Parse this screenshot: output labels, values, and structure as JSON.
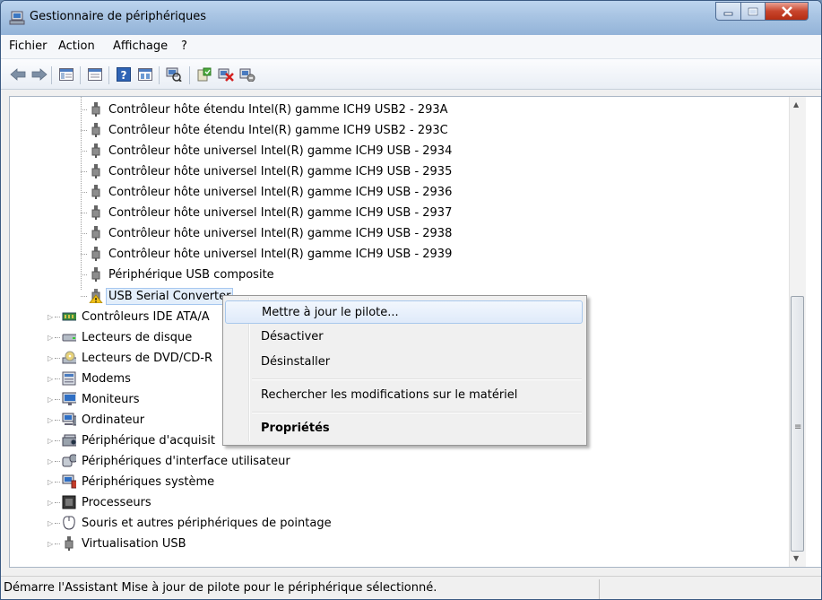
{
  "window": {
    "title": "Gestionnaire de périphériques",
    "controls": {
      "minimize": "—",
      "maximize": "□",
      "close": "✕"
    }
  },
  "menubar": [
    "Fichier",
    "Action",
    "Affichage",
    "?"
  ],
  "toolbar": [
    "back-arrow-icon",
    "forward-arrow-icon",
    "console-tree-icon",
    "properties-icon",
    "help-icon",
    "view-icon",
    "scan-hardware-icon",
    "update-driver-icon",
    "uninstall-icon",
    "disable-icon"
  ],
  "tree": {
    "usb_children": [
      "Contrôleur hôte étendu Intel(R) gamme ICH9 USB2 - 293A",
      "Contrôleur hôte étendu Intel(R) gamme ICH9 USB2 - 293C",
      "Contrôleur hôte universel Intel(R) gamme ICH9 USB - 2934",
      "Contrôleur hôte universel Intel(R) gamme ICH9 USB - 2935",
      "Contrôleur hôte universel Intel(R) gamme ICH9 USB - 2936",
      "Contrôleur hôte universel Intel(R) gamme ICH9 USB - 2937",
      "Contrôleur hôte universel Intel(R) gamme ICH9 USB - 2938",
      "Contrôleur hôte universel Intel(R) gamme ICH9 USB - 2939",
      "Périphérique USB composite"
    ],
    "selected": "USB Serial Converter",
    "categories": [
      "Contrôleurs IDE ATA/A",
      "Lecteurs de disque",
      "Lecteurs de DVD/CD-R",
      "Modems",
      "Moniteurs",
      "Ordinateur",
      "Périphérique d'acquisit",
      "Périphériques d'interface utilisateur",
      "Périphériques système",
      "Processeurs",
      "Souris et autres périphériques de pointage",
      "Virtualisation USB"
    ]
  },
  "context_menu": {
    "items": [
      "Mettre à jour le pilote...",
      "Désactiver",
      "Désinstaller",
      "Rechercher les modifications sur le matériel",
      "Propriétés"
    ]
  },
  "status": "Démarre l'Assistant Mise à jour de pilote pour le périphérique sélectionné.",
  "colors": {
    "selection_bg": "#e3eefb",
    "menu_highlight_border": "#a8c8ec",
    "warning": "#f2c21a"
  }
}
